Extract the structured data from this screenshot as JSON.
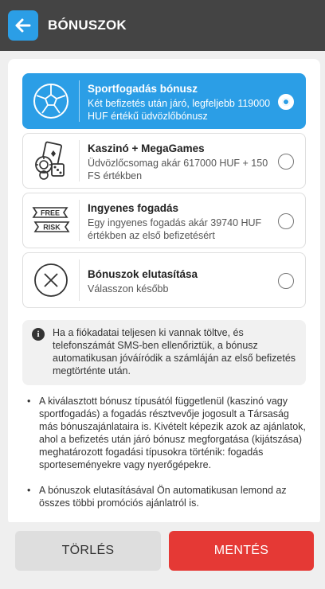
{
  "header": {
    "title": "BÓNUSZOK"
  },
  "colors": {
    "accent": "#2b9ee6",
    "header_bg": "#444444",
    "danger": "#e53935"
  },
  "options": [
    {
      "icon": "soccer-ball-icon",
      "title": "Sportfogadás bónusz",
      "desc": "Két befizetés után járó, legfeljebb 119000 HUF értékű üdvözlőbónusz",
      "selected": true
    },
    {
      "icon": "casino-chips-dice-icon",
      "title": "Kaszinó + MegaGames",
      "desc": "Üdvözlőcsomag akár 617000 HUF + 150 FS értékben",
      "selected": false
    },
    {
      "icon": "free-risk-ticket-icon",
      "title": "Ingyenes fogadás",
      "desc": "Egy ingyenes fogadás akár 39740 HUF értékben az első befizetésért",
      "selected": false,
      "icon_text": [
        "FREE",
        "RISK"
      ]
    },
    {
      "icon": "decline-x-icon",
      "title": "Bónuszok elutasítása",
      "desc": "Válasszon később",
      "selected": false
    }
  ],
  "info": {
    "icon": "info-icon",
    "text": "Ha a fiókadatai teljesen ki vannak töltve, és telefonszámát SMS-ben ellenőriztük, a bónusz automatikusan jóváíródik a számláján az első befizetés megtörténte után."
  },
  "notes": [
    "A kiválasztott bónusz típusától függetlenül (kaszinó vagy sportfogadás) a fogadás résztvevője jogosult a Társaság más bónuszajánlataira is. Kivételt képezik azok az ajánlatok, ahol a befizetés után járó bónusz megforgatása (kijátszása) meghatározott fogadási típusokra történik: fogadás sporteseményekre vagy nyerőgépekre.",
    "A bónuszok elutasításával Ön automatikusan lemond az összes többi promóciós ajánlatról is."
  ],
  "buttons": {
    "cancel": "TÖRLÉS",
    "save": "MENTÉS"
  }
}
